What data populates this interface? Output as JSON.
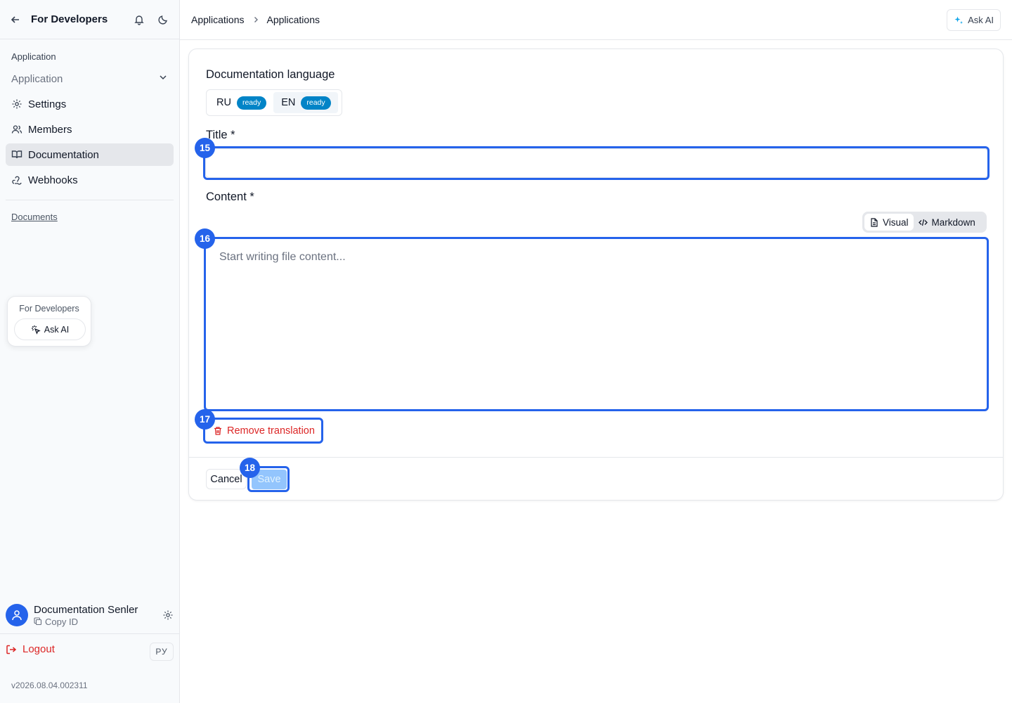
{
  "sidebar": {
    "header_title": "For Developers",
    "section_label": "Application",
    "app_select_value": "Application",
    "nav": [
      {
        "label": "Settings",
        "icon": "gear-icon"
      },
      {
        "label": "Members",
        "icon": "users-icon"
      },
      {
        "label": "Documentation",
        "icon": "book-icon",
        "active": true
      },
      {
        "label": "Webhooks",
        "icon": "webhook-icon"
      }
    ],
    "docs_link": "Documents",
    "float_card": {
      "title": "For Developers",
      "button": "Ask AI"
    },
    "user": {
      "name": "Documentation Senler",
      "copy_id": "Copy ID"
    },
    "logout": "Logout",
    "lang_badge": "РУ",
    "version": "v2026.08.04.002311"
  },
  "topbar": {
    "breadcrumbs": [
      "Applications",
      "Applications"
    ],
    "ask_ai": "Ask AI"
  },
  "form": {
    "doc_lang_label": "Documentation language",
    "langs": [
      {
        "code": "RU",
        "status": "ready"
      },
      {
        "code": "EN",
        "status": "ready",
        "active": true
      }
    ],
    "title_label": "Title *",
    "title_value": "",
    "content_label": "Content *",
    "modes": [
      "Visual",
      "Markdown"
    ],
    "content_placeholder": "Start writing file content...",
    "remove_translation": "Remove translation",
    "cancel": "Cancel",
    "save": "Save"
  },
  "markers": [
    "15",
    "16",
    "17",
    "18"
  ],
  "colors": {
    "accent": "#2563eb",
    "danger": "#dc2626",
    "badge": "#0284c7",
    "save_disabled": "#93c5fd"
  }
}
